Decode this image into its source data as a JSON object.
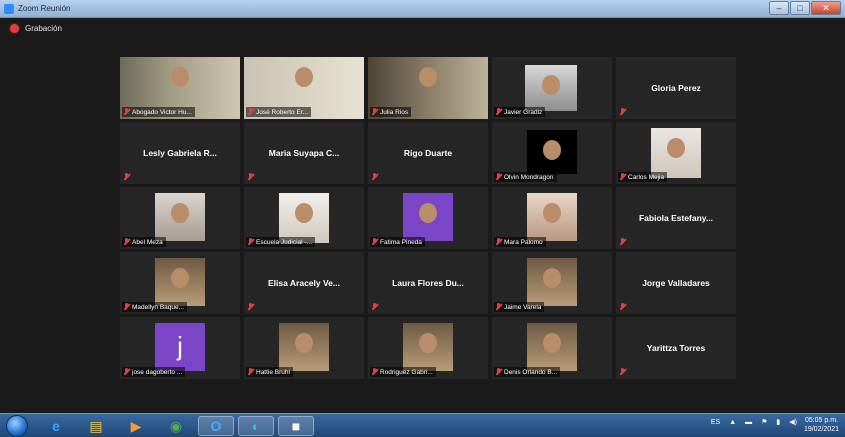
{
  "window": {
    "title": "Zoom Reunión",
    "controls": [
      "–",
      "□",
      "✕"
    ]
  },
  "recording": {
    "label": "Grabación",
    "color": "#e23c3c"
  },
  "participants": [
    {
      "name": "Abogado Victor Hu...",
      "video": true,
      "active": true
    },
    {
      "name": "José Roberto Er...",
      "video": true
    },
    {
      "name": "Julia Rios",
      "video": true
    },
    {
      "name": "Javier Gradiz",
      "video": true
    },
    {
      "name": "Gloria Perez",
      "video": false
    },
    {
      "name": "Lesly Gabriela R...",
      "video": false
    },
    {
      "name": "Maria Suyapa C...",
      "video": false
    },
    {
      "name": "Rigo Duarte",
      "video": false
    },
    {
      "name": "Olvin Mondragon",
      "video": true
    },
    {
      "name": "Carlos Mejia",
      "video": true
    },
    {
      "name": "Abel Meza",
      "video": true
    },
    {
      "name": "Escuela Judicial -...",
      "video": true
    },
    {
      "name": "Fatima Pineda",
      "video": true
    },
    {
      "name": "Mara Palomo",
      "video": true
    },
    {
      "name": "Fabiola Estefany...",
      "video": false
    },
    {
      "name": "Madellyn Baque...",
      "video": true
    },
    {
      "name": "Elisa Aracely Ve...",
      "video": false
    },
    {
      "name": "Laura Flores Du...",
      "video": false
    },
    {
      "name": "Jaime Varela",
      "video": true
    },
    {
      "name": "Jorge Valladares",
      "video": false
    },
    {
      "name": "jose dagoberto ...",
      "video": true,
      "avatar_letter": "j"
    },
    {
      "name": "Hattie Bruhl",
      "video": true
    },
    {
      "name": "Rodriguez Gabri...",
      "video": true
    },
    {
      "name": "Denis Orlando B...",
      "video": true
    },
    {
      "name": "Yarittza Torres",
      "video": false
    }
  ],
  "taskbar": {
    "start": "start-orb",
    "apps": [
      {
        "name": "internet-explorer-icon",
        "glyph": "e",
        "color": "#3aa0ff"
      },
      {
        "name": "file-explorer-icon",
        "glyph": "▤",
        "color": "#f0c85a"
      },
      {
        "name": "media-player-icon",
        "glyph": "▶",
        "color": "#ff9b2a"
      },
      {
        "name": "chrome-icon",
        "glyph": "◉",
        "color": "#4caf50"
      },
      {
        "name": "outlook-icon",
        "glyph": "O",
        "color": "#4aa3ff"
      },
      {
        "name": "edge-icon",
        "glyph": "◐",
        "color": "#38c0e0"
      },
      {
        "name": "zoom-icon",
        "glyph": "■",
        "color": "#ffffff"
      }
    ],
    "tray": {
      "lang": "ES"
    },
    "clock": {
      "time": "05:05 p.m.",
      "date": "19/02/2021"
    }
  }
}
